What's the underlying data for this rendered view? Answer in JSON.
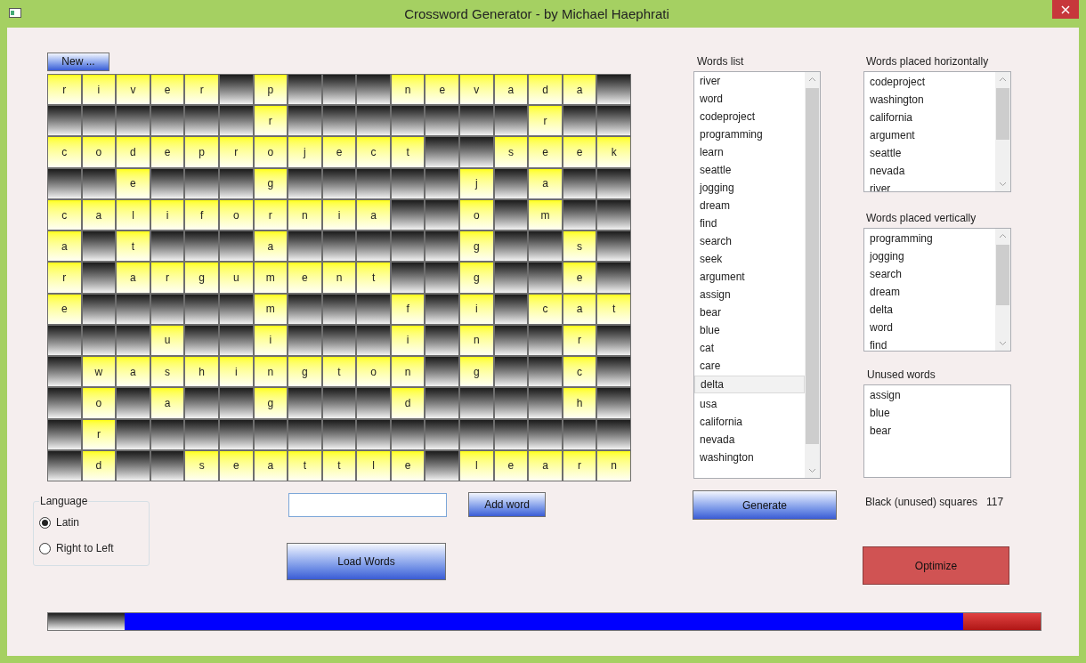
{
  "window": {
    "title": "Crossword Generator - by Michael Haephrati"
  },
  "new_button": "New ...",
  "grid": [
    [
      {
        "kind": "letter",
        "text": "r"
      },
      {
        "kind": "letter",
        "text": "i"
      },
      {
        "kind": "letter",
        "text": "v"
      },
      {
        "kind": "letter",
        "text": "e"
      },
      {
        "kind": "letter",
        "text": "r"
      },
      {
        "kind": "block"
      },
      {
        "kind": "letter",
        "text": "p"
      },
      {
        "kind": "block"
      },
      {
        "kind": "block"
      },
      {
        "kind": "block"
      },
      {
        "kind": "letter",
        "text": "n"
      },
      {
        "kind": "letter",
        "text": "e"
      },
      {
        "kind": "letter",
        "text": "v"
      },
      {
        "kind": "letter",
        "text": "a"
      },
      {
        "kind": "letter",
        "text": "d"
      },
      {
        "kind": "letter",
        "text": "a"
      },
      {
        "kind": "block"
      }
    ],
    [
      {
        "kind": "block"
      },
      {
        "kind": "block"
      },
      {
        "kind": "block"
      },
      {
        "kind": "block"
      },
      {
        "kind": "block"
      },
      {
        "kind": "block"
      },
      {
        "kind": "letter",
        "text": "r"
      },
      {
        "kind": "block"
      },
      {
        "kind": "block"
      },
      {
        "kind": "block"
      },
      {
        "kind": "block"
      },
      {
        "kind": "block"
      },
      {
        "kind": "block"
      },
      {
        "kind": "block"
      },
      {
        "kind": "letter",
        "text": "r"
      },
      {
        "kind": "block"
      },
      {
        "kind": "block"
      }
    ],
    [
      {
        "kind": "letter",
        "text": "c"
      },
      {
        "kind": "letter",
        "text": "o"
      },
      {
        "kind": "letter",
        "text": "d"
      },
      {
        "kind": "letter",
        "text": "e"
      },
      {
        "kind": "letter",
        "text": "p"
      },
      {
        "kind": "letter",
        "text": "r"
      },
      {
        "kind": "letter",
        "text": "o"
      },
      {
        "kind": "letter",
        "text": "j"
      },
      {
        "kind": "letter",
        "text": "e"
      },
      {
        "kind": "letter",
        "text": "c"
      },
      {
        "kind": "letter",
        "text": "t"
      },
      {
        "kind": "block"
      },
      {
        "kind": "block"
      },
      {
        "kind": "letter",
        "text": "s"
      },
      {
        "kind": "letter",
        "text": "e"
      },
      {
        "kind": "letter",
        "text": "e"
      },
      {
        "kind": "letter",
        "text": "k"
      }
    ],
    [
      {
        "kind": "block"
      },
      {
        "kind": "block"
      },
      {
        "kind": "letter",
        "text": "e"
      },
      {
        "kind": "block"
      },
      {
        "kind": "block"
      },
      {
        "kind": "block"
      },
      {
        "kind": "letter",
        "text": "g"
      },
      {
        "kind": "block"
      },
      {
        "kind": "block"
      },
      {
        "kind": "block"
      },
      {
        "kind": "block"
      },
      {
        "kind": "block"
      },
      {
        "kind": "letter",
        "text": "j"
      },
      {
        "kind": "block"
      },
      {
        "kind": "letter",
        "text": "a"
      },
      {
        "kind": "block"
      },
      {
        "kind": "block"
      }
    ],
    [
      {
        "kind": "letter",
        "text": "c"
      },
      {
        "kind": "letter",
        "text": "a"
      },
      {
        "kind": "letter",
        "text": "l"
      },
      {
        "kind": "letter",
        "text": "i"
      },
      {
        "kind": "letter",
        "text": "f"
      },
      {
        "kind": "letter",
        "text": "o"
      },
      {
        "kind": "letter",
        "text": "r"
      },
      {
        "kind": "letter",
        "text": "n"
      },
      {
        "kind": "letter",
        "text": "i"
      },
      {
        "kind": "letter",
        "text": "a"
      },
      {
        "kind": "block"
      },
      {
        "kind": "block"
      },
      {
        "kind": "letter",
        "text": "o"
      },
      {
        "kind": "block"
      },
      {
        "kind": "letter",
        "text": "m"
      },
      {
        "kind": "block"
      },
      {
        "kind": "block"
      }
    ],
    [
      {
        "kind": "letter",
        "text": "a"
      },
      {
        "kind": "block"
      },
      {
        "kind": "letter",
        "text": "t"
      },
      {
        "kind": "block"
      },
      {
        "kind": "block"
      },
      {
        "kind": "block"
      },
      {
        "kind": "letter",
        "text": "a"
      },
      {
        "kind": "block"
      },
      {
        "kind": "block"
      },
      {
        "kind": "block"
      },
      {
        "kind": "block"
      },
      {
        "kind": "block"
      },
      {
        "kind": "letter",
        "text": "g"
      },
      {
        "kind": "block"
      },
      {
        "kind": "block"
      },
      {
        "kind": "letter",
        "text": "s"
      },
      {
        "kind": "block"
      }
    ],
    [
      {
        "kind": "letter",
        "text": "r"
      },
      {
        "kind": "block"
      },
      {
        "kind": "letter",
        "text": "a"
      },
      {
        "kind": "letter",
        "text": "r"
      },
      {
        "kind": "letter",
        "text": "g"
      },
      {
        "kind": "letter",
        "text": "u"
      },
      {
        "kind": "letter",
        "text": "m"
      },
      {
        "kind": "letter",
        "text": "e"
      },
      {
        "kind": "letter",
        "text": "n"
      },
      {
        "kind": "letter",
        "text": "t"
      },
      {
        "kind": "block"
      },
      {
        "kind": "block"
      },
      {
        "kind": "letter",
        "text": "g"
      },
      {
        "kind": "block"
      },
      {
        "kind": "block"
      },
      {
        "kind": "letter",
        "text": "e"
      },
      {
        "kind": "block"
      }
    ],
    [
      {
        "kind": "letter",
        "text": "e"
      },
      {
        "kind": "block"
      },
      {
        "kind": "block"
      },
      {
        "kind": "block"
      },
      {
        "kind": "block"
      },
      {
        "kind": "block"
      },
      {
        "kind": "letter",
        "text": "m"
      },
      {
        "kind": "block"
      },
      {
        "kind": "block"
      },
      {
        "kind": "block"
      },
      {
        "kind": "letter",
        "text": "f"
      },
      {
        "kind": "block"
      },
      {
        "kind": "letter",
        "text": "i"
      },
      {
        "kind": "block"
      },
      {
        "kind": "letter",
        "text": "c"
      },
      {
        "kind": "letter",
        "text": "a"
      },
      {
        "kind": "letter",
        "text": "t"
      }
    ],
    [
      {
        "kind": "block"
      },
      {
        "kind": "block"
      },
      {
        "kind": "block"
      },
      {
        "kind": "letter",
        "text": "u"
      },
      {
        "kind": "block"
      },
      {
        "kind": "block"
      },
      {
        "kind": "letter",
        "text": "i"
      },
      {
        "kind": "block"
      },
      {
        "kind": "block"
      },
      {
        "kind": "block"
      },
      {
        "kind": "letter",
        "text": "i"
      },
      {
        "kind": "block"
      },
      {
        "kind": "letter",
        "text": "n"
      },
      {
        "kind": "block"
      },
      {
        "kind": "block"
      },
      {
        "kind": "letter",
        "text": "r"
      },
      {
        "kind": "block"
      }
    ],
    [
      {
        "kind": "block"
      },
      {
        "kind": "letter",
        "text": "w"
      },
      {
        "kind": "letter",
        "text": "a"
      },
      {
        "kind": "letter",
        "text": "s"
      },
      {
        "kind": "letter",
        "text": "h"
      },
      {
        "kind": "letter",
        "text": "i"
      },
      {
        "kind": "letter",
        "text": "n"
      },
      {
        "kind": "letter",
        "text": "g"
      },
      {
        "kind": "letter",
        "text": "t"
      },
      {
        "kind": "letter",
        "text": "o"
      },
      {
        "kind": "letter",
        "text": "n"
      },
      {
        "kind": "block"
      },
      {
        "kind": "letter",
        "text": "g"
      },
      {
        "kind": "block"
      },
      {
        "kind": "block"
      },
      {
        "kind": "letter",
        "text": "c"
      },
      {
        "kind": "block"
      }
    ],
    [
      {
        "kind": "block"
      },
      {
        "kind": "letter",
        "text": "o"
      },
      {
        "kind": "block"
      },
      {
        "kind": "letter",
        "text": "a"
      },
      {
        "kind": "block"
      },
      {
        "kind": "block"
      },
      {
        "kind": "letter",
        "text": "g"
      },
      {
        "kind": "block"
      },
      {
        "kind": "block"
      },
      {
        "kind": "block"
      },
      {
        "kind": "letter",
        "text": "d"
      },
      {
        "kind": "block"
      },
      {
        "kind": "block"
      },
      {
        "kind": "block"
      },
      {
        "kind": "block"
      },
      {
        "kind": "letter",
        "text": "h"
      },
      {
        "kind": "block"
      }
    ],
    [
      {
        "kind": "block"
      },
      {
        "kind": "letter",
        "text": "r"
      },
      {
        "kind": "block"
      },
      {
        "kind": "block"
      },
      {
        "kind": "block"
      },
      {
        "kind": "block"
      },
      {
        "kind": "block"
      },
      {
        "kind": "block"
      },
      {
        "kind": "block"
      },
      {
        "kind": "block"
      },
      {
        "kind": "block"
      },
      {
        "kind": "block"
      },
      {
        "kind": "block"
      },
      {
        "kind": "block"
      },
      {
        "kind": "block"
      },
      {
        "kind": "block"
      },
      {
        "kind": "block"
      }
    ],
    [
      {
        "kind": "block"
      },
      {
        "kind": "letter",
        "text": "d"
      },
      {
        "kind": "block"
      },
      {
        "kind": "block"
      },
      {
        "kind": "letter",
        "text": "s"
      },
      {
        "kind": "letter",
        "text": "e"
      },
      {
        "kind": "letter",
        "text": "a"
      },
      {
        "kind": "letter",
        "text": "t"
      },
      {
        "kind": "letter",
        "text": "t"
      },
      {
        "kind": "letter",
        "text": "l"
      },
      {
        "kind": "letter",
        "text": "e"
      },
      {
        "kind": "block"
      },
      {
        "kind": "letter",
        "text": "l"
      },
      {
        "kind": "letter",
        "text": "e"
      },
      {
        "kind": "letter",
        "text": "a"
      },
      {
        "kind": "letter",
        "text": "r"
      },
      {
        "kind": "letter",
        "text": "n"
      }
    ]
  ],
  "language": {
    "title": "Language",
    "options": [
      {
        "label": "Latin",
        "selected": true
      },
      {
        "label": "Right to Left",
        "selected": false
      }
    ]
  },
  "add_word_button": "Add word",
  "load_words_button": "Load Words",
  "words_list": {
    "title": "Words list",
    "items": [
      {
        "text": "river",
        "selected": false
      },
      {
        "text": "word",
        "selected": false
      },
      {
        "text": "codeproject",
        "selected": false
      },
      {
        "text": "programming",
        "selected": false
      },
      {
        "text": "learn",
        "selected": false
      },
      {
        "text": "seattle",
        "selected": false
      },
      {
        "text": "jogging",
        "selected": false
      },
      {
        "text": "dream",
        "selected": false
      },
      {
        "text": "find",
        "selected": false
      },
      {
        "text": "search",
        "selected": false
      },
      {
        "text": "seek",
        "selected": false
      },
      {
        "text": "argument",
        "selected": false
      },
      {
        "text": "assign",
        "selected": false
      },
      {
        "text": "bear",
        "selected": false
      },
      {
        "text": "blue",
        "selected": false
      },
      {
        "text": "cat",
        "selected": false
      },
      {
        "text": "care",
        "selected": false
      },
      {
        "text": "delta",
        "selected": true
      },
      {
        "text": "usa",
        "selected": false
      },
      {
        "text": "california",
        "selected": false
      },
      {
        "text": "nevada",
        "selected": false
      },
      {
        "text": "washington",
        "selected": false
      }
    ]
  },
  "generate_button": "Generate",
  "horizontal": {
    "title": "Words placed horizontally",
    "items": [
      "codeproject",
      "washington",
      "california",
      "argument",
      "seattle",
      "nevada",
      "river"
    ]
  },
  "vertical": {
    "title": "Words placed vertically",
    "items": [
      "programming",
      "jogging",
      "search",
      "dream",
      "delta",
      "word",
      "find"
    ]
  },
  "unused": {
    "title": "Unused words",
    "items": [
      "assign",
      "blue",
      "bear"
    ]
  },
  "black_squares": {
    "label": "Black (unused) squares",
    "value": "117"
  },
  "optimize_button": "Optimize",
  "progress": {
    "level": 0.922
  }
}
